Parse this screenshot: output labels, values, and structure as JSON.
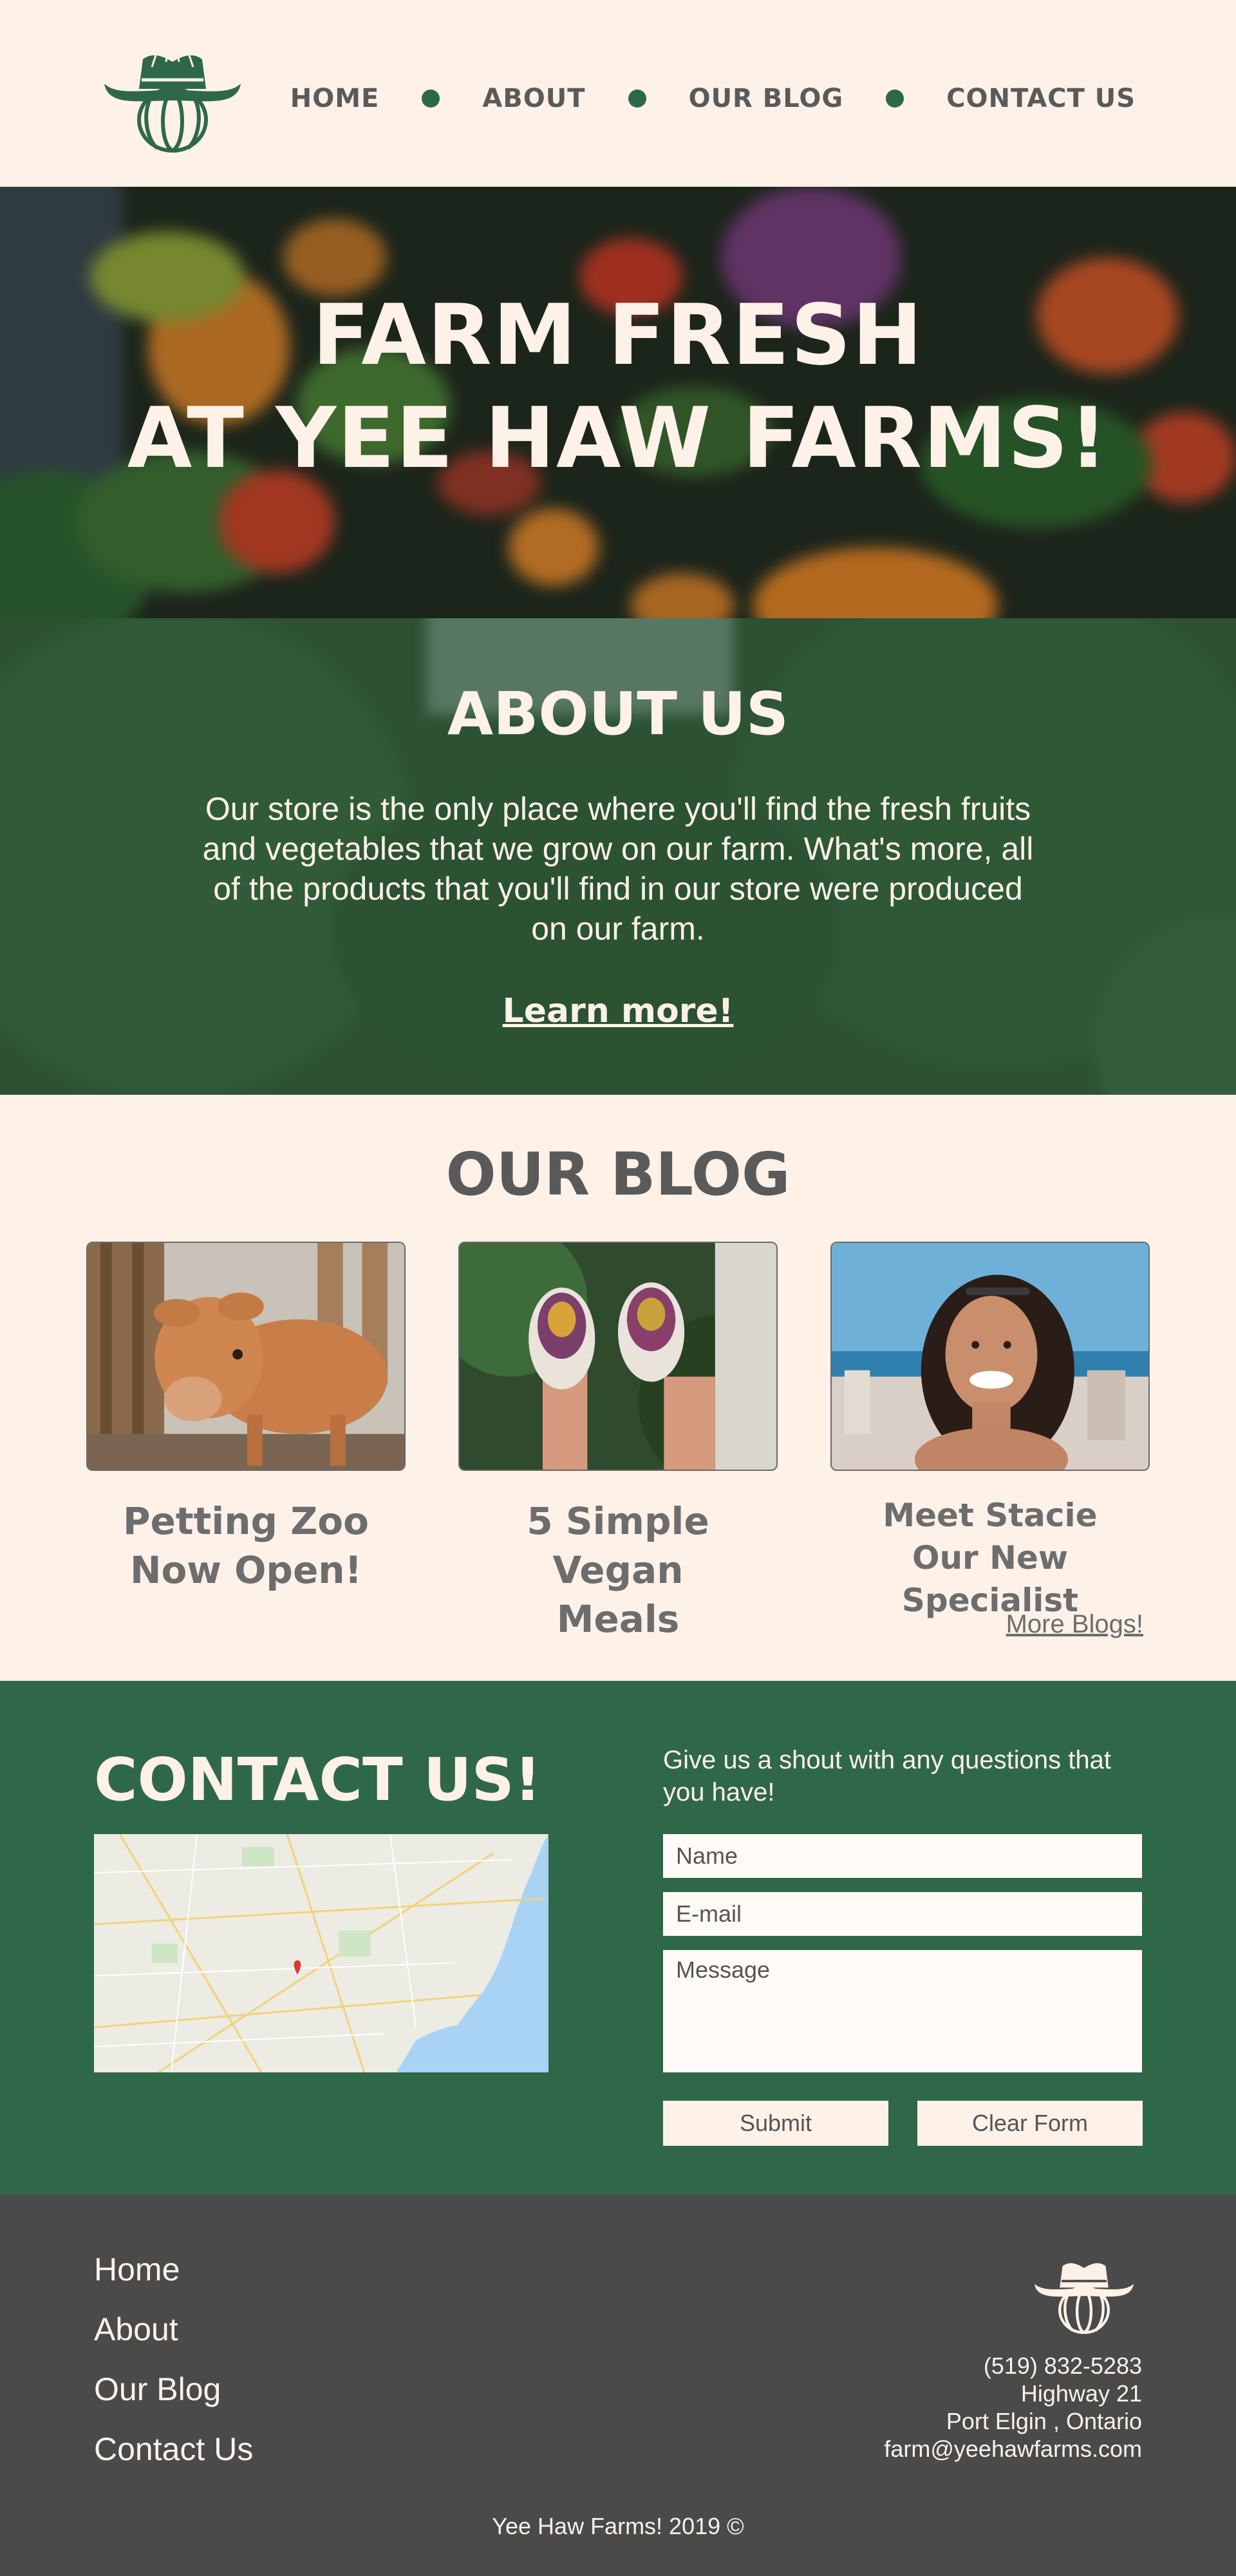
{
  "header": {
    "nav": [
      "HOME",
      "ABOUT",
      "OUR BLOG",
      "CONTACT US"
    ]
  },
  "hero": {
    "title_line1": "FARM FRESH",
    "title_line2": "AT YEE HAW FARMS!"
  },
  "about": {
    "title": "ABOUT US",
    "text": "Our store is the only place where you'll find the fresh fruits and vegetables that we grow on our farm. What's more, all of the products that you'll find in our store were produced on our farm.",
    "link": "Learn more!"
  },
  "blog": {
    "title": "OUR BLOG",
    "posts": [
      {
        "line1": "Petting Zoo",
        "line2": "Now Open!",
        "image": "calf-photo"
      },
      {
        "line1": "5 Simple Vegan",
        "line2": "Meals",
        "image": "vegan-wraps-photo"
      },
      {
        "line1": "Meet Stacie",
        "line2": "Our New Specialist",
        "image": "woman-portrait-photo"
      }
    ],
    "more": "More Blogs!"
  },
  "contact": {
    "title": "CONTACT US!",
    "intro": "Give us a shout with any questions that you have!",
    "fields": {
      "name_placeholder": "Name",
      "email_placeholder": "E-mail",
      "message_placeholder": "Message"
    },
    "submit": "Submit",
    "clear": "Clear Form"
  },
  "footer": {
    "nav": [
      "Home",
      "About",
      "Our Blog",
      "Contact Us"
    ],
    "phone": "(519) 832-5283",
    "address1": "Highway 21",
    "address2": "Port Elgin , Ontario",
    "email": "farm@yeehawfarms.com",
    "copyright": "Yee Haw Farms! 2019 ©"
  },
  "colors": {
    "cream": "#fdf1e8",
    "green": "#2f6848",
    "text_gray": "#5a5a5a",
    "footer_gray": "#4a4a4a"
  }
}
